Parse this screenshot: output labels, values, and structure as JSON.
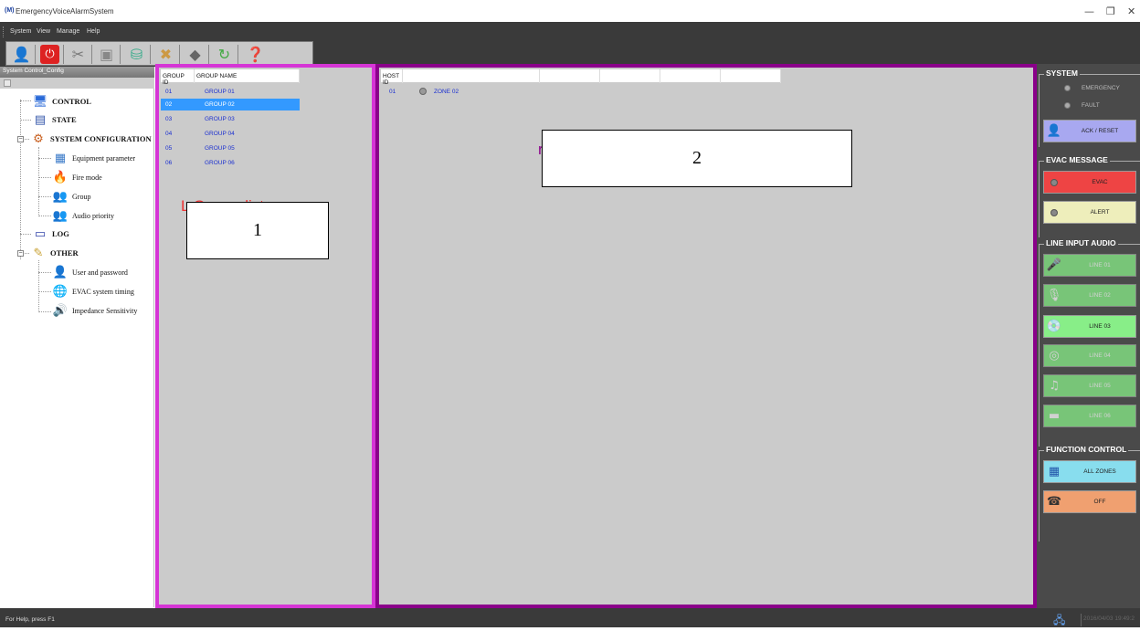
{
  "window": {
    "icon_text": "(M)",
    "title": "EmergencyVoiceAlarmSystem",
    "minimize": "—",
    "restore": "❐",
    "close": "✕"
  },
  "menu": [
    "System",
    "View",
    "Manage",
    "Help"
  ],
  "toolbar": {
    "icons": [
      "user-icon",
      "power-icon",
      "tools-icon",
      "save-icon",
      "network-icon",
      "connect-icon",
      "erase-icon",
      "refresh-icon",
      "help-icon"
    ]
  },
  "sidebar": {
    "title": "System Control_Config",
    "tree": {
      "control": "CONTROL",
      "state": "STATE",
      "system_configuration": "SYSTEM CONFIGURATION",
      "equipment_parameter": "Equipment parameter",
      "fire_mode": "Fire mode",
      "group": "Group",
      "audio_priority": "Audio priority",
      "log": "LOG",
      "other": "OTHER",
      "user_and_password": "User and password",
      "evac_system_timing": "EVAC system timing",
      "impedance_sensitivity": "Impedance Sensitivity"
    }
  },
  "group_list": {
    "columns": [
      "GROUP ID",
      "GROUP NAME"
    ],
    "rows": [
      {
        "id": "01",
        "name": "GROUP 01"
      },
      {
        "id": "02",
        "name": "GROUP 02",
        "selected": true
      },
      {
        "id": "03",
        "name": "GROUP 03"
      },
      {
        "id": "04",
        "name": "GROUP 04"
      },
      {
        "id": "05",
        "name": "GROUP 05"
      },
      {
        "id": "06",
        "name": "GROUP 06"
      }
    ],
    "partial_label": "L     Gro up  list",
    "overlay_label": "1"
  },
  "host_list": {
    "columns": [
      "HOST ID"
    ],
    "rows": [
      {
        "id": "01",
        "zone": "ZONE 02"
      }
    ],
    "partial_label": "r",
    "overlay_label": "2"
  },
  "right_panel": {
    "system": {
      "title": "SYSTEM",
      "emergency": "EMERGENCY",
      "fault": "FAULT",
      "ack_reset": "ACK / RESET"
    },
    "evac_message": {
      "title": "EVAC MESSAGE",
      "evac": "EVAC",
      "alert": "ALERT"
    },
    "line_input_audio": {
      "title": "LINE INPUT AUDIO",
      "lines": [
        "LINE 01",
        "LINE 02",
        "LINE 03",
        "LINE 04",
        "LINE 05",
        "LINE 06"
      ]
    },
    "function_control": {
      "title": "FUNCTION CONTROL",
      "all_zones": "ALL ZONES",
      "off": "OFF"
    }
  },
  "colors": {
    "panel1_border": "#d535d5",
    "panel2_border": "#8a008a",
    "selected_row": "#3399ff",
    "evac_button": "#ee4444",
    "alert_button": "#eeeebb",
    "line_button": "#88ee88",
    "all_zones_button": "#88ddee",
    "off_button": "#f0a070",
    "ack_button": "#a8a8f0"
  },
  "status": {
    "help_text": "For Help, press F1",
    "datetime": "2016/04/03 19:49:2"
  }
}
